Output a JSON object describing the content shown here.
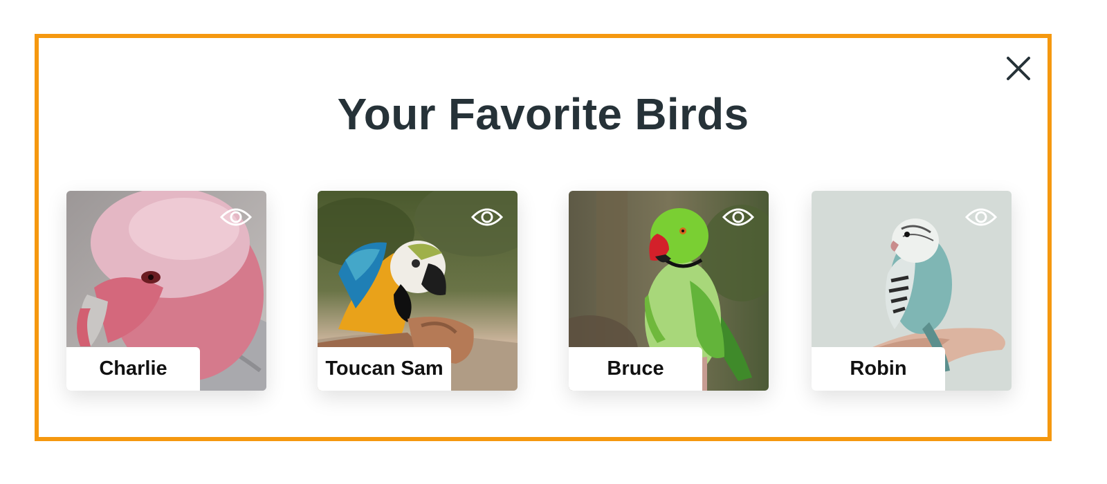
{
  "dialog": {
    "title": "Your Favorite Birds",
    "close_icon": "close-icon",
    "border_color": "#f5980f"
  },
  "birds": [
    {
      "name": "Charlie",
      "view_icon": "eye-icon"
    },
    {
      "name": "Toucan Sam",
      "view_icon": "eye-icon"
    },
    {
      "name": "Bruce",
      "view_icon": "eye-icon"
    },
    {
      "name": "Robin",
      "view_icon": "eye-icon"
    }
  ]
}
